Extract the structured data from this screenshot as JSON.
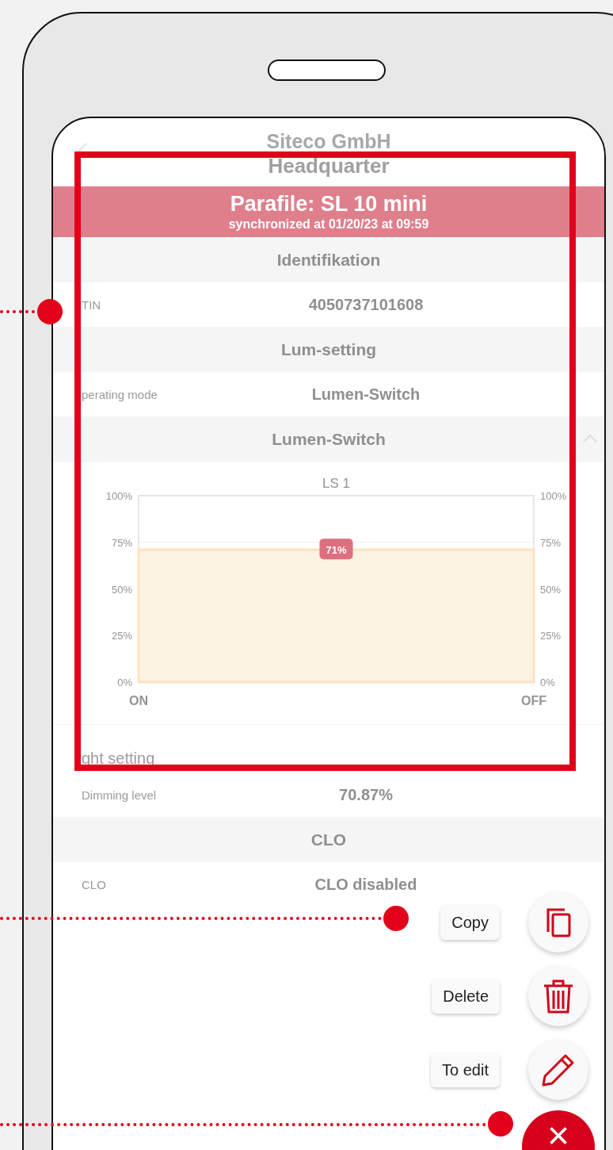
{
  "header": {
    "title": "Siteco GmbH",
    "subtitle": "Headquarter"
  },
  "banner": {
    "title": "Parafile: SL 10 mini",
    "subtitle": "synchronized at 01/20/23 at 09:59"
  },
  "sections": [
    {
      "kind": "header",
      "label": "Identifikation"
    },
    {
      "kind": "row",
      "key": "TIN",
      "value": "4050737101608"
    },
    {
      "kind": "header",
      "label": "Lum-setting"
    },
    {
      "kind": "row",
      "key": "perating mode",
      "value": "Lumen-Switch"
    },
    {
      "kind": "header",
      "label": "Lumen-Switch",
      "expanded": true
    },
    {
      "kind": "chart",
      "chart_data": {
        "type": "area",
        "title": "LS 1",
        "categories": [
          "ON",
          "OFF"
        ],
        "series": [
          {
            "color": "#fbe3be",
            "values": [
              71,
              71
            ]
          }
        ],
        "ylim": [
          0,
          100
        ],
        "yticks": [
          {
            "value": 0,
            "label": "0%"
          },
          {
            "value": 25,
            "label": "25%"
          },
          {
            "value": 50,
            "label": "50%"
          },
          {
            "value": 75,
            "label": "75%"
          },
          {
            "value": 100,
            "label": "100%"
          }
        ],
        "value_labels": [
          "71%"
        ]
      }
    },
    {
      "kind": "title",
      "label": "ght setting"
    },
    {
      "kind": "row",
      "key": "Dimming level",
      "value": "70.87%"
    },
    {
      "kind": "header",
      "label": "CLO"
    },
    {
      "kind": "row",
      "key": "CLO",
      "value": "CLO disabled"
    }
  ],
  "actions": [
    {
      "kind": "copy",
      "label": "Copy"
    },
    {
      "kind": "delete",
      "label": "Delete"
    },
    {
      "kind": "edit",
      "label": "To edit"
    }
  ],
  "close_button": {
    "label": "×"
  }
}
